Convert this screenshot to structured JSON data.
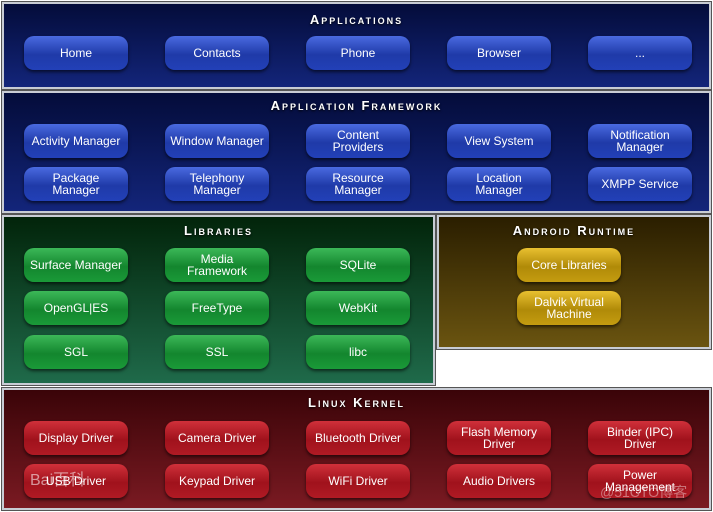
{
  "layers": {
    "applications": {
      "title": "Applications",
      "items": [
        "Home",
        "Contacts",
        "Phone",
        "Browser",
        "..."
      ]
    },
    "framework": {
      "title": "Application Framework",
      "items": [
        "Activity Manager",
        "Window Manager",
        "Content Providers",
        "View System",
        "Notification Manager",
        "Package Manager",
        "Telephony Manager",
        "Resource Manager",
        "Location Manager",
        "XMPP Service"
      ]
    },
    "libraries": {
      "title": "Libraries",
      "items": [
        "Surface Manager",
        "Media Framework",
        "SQLite",
        "OpenGL|ES",
        "FreeType",
        "WebKit",
        "SGL",
        "SSL",
        "libc"
      ]
    },
    "runtime": {
      "title": "Android Runtime",
      "items": [
        "Core Libraries",
        "Dalvik Virtual Machine"
      ]
    },
    "kernel": {
      "title": "Linux Kernel",
      "items": [
        "Display Driver",
        "Camera Driver",
        "Bluetooth Driver",
        "Flash Memory Driver",
        "Binder (IPC) Driver",
        "USB Driver",
        "Keypad Driver",
        "WiFi Driver",
        "Audio Drivers",
        "Power Management"
      ]
    }
  },
  "colors": {
    "applications": "#13257a",
    "framework": "#13257a",
    "libraries": "#1f6a4a",
    "runtime": "#6a5410",
    "kernel": "#7a1a22"
  },
  "watermarks": [
    "Bai百科",
    "@51CTO博客"
  ]
}
